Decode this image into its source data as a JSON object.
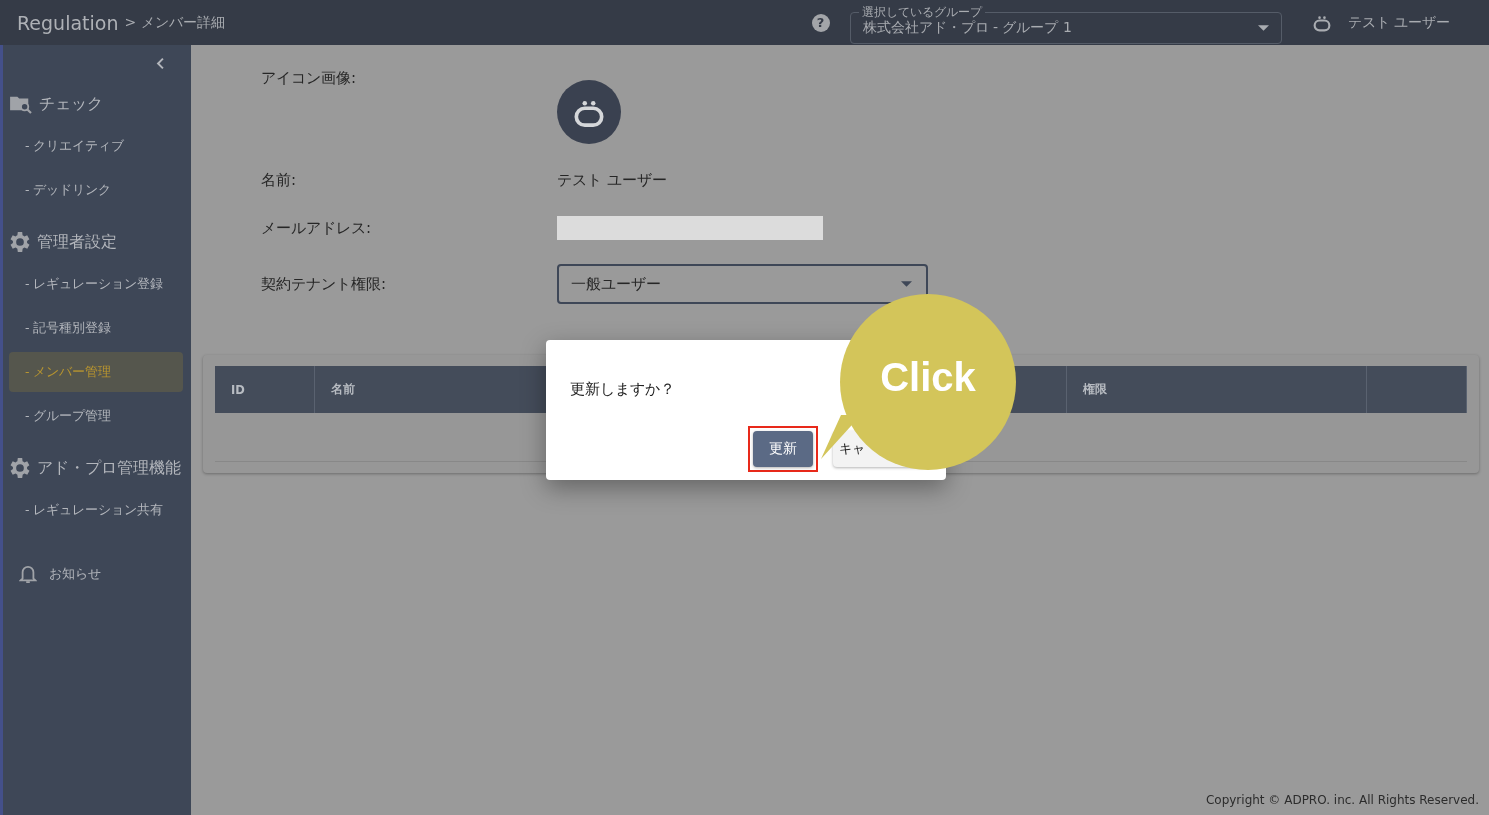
{
  "header": {
    "app_title": "Regulation",
    "breadcrumb": "> メンバー詳細",
    "help": "?",
    "group_select": {
      "label": "選択しているグループ",
      "value": "株式会社アド・プロ - グループ 1"
    },
    "user_name": "テスト ユーザー"
  },
  "sidebar": {
    "sections": [
      {
        "kind": "folder-search",
        "title": "チェック",
        "items": [
          {
            "label": "- クリエイティブ",
            "selected": false
          },
          {
            "label": "- デッドリンク",
            "selected": false
          }
        ]
      },
      {
        "kind": "gear",
        "title": "管理者設定",
        "items": [
          {
            "label": "- レギュレーション登録",
            "selected": false
          },
          {
            "label": "- 記号種別登録",
            "selected": false
          },
          {
            "label": "- メンバー管理",
            "selected": true
          },
          {
            "label": "- グループ管理",
            "selected": false
          }
        ]
      },
      {
        "kind": "gear",
        "title": "アド・プロ管理機能",
        "items": [
          {
            "label": "- レギュレーション共有",
            "selected": false
          }
        ]
      }
    ],
    "notice": "お知らせ"
  },
  "detail": {
    "fields": [
      {
        "kind": "avatar",
        "label": "アイコン画像:"
      },
      {
        "kind": "text",
        "label": "名前:",
        "value": "テスト ユーザー"
      },
      {
        "kind": "redacted",
        "label": "メールアドレス:"
      },
      {
        "kind": "select",
        "label": "契約テナント権限:",
        "value": "一般ユーザー"
      }
    ]
  },
  "table": {
    "columns": [
      "ID",
      "名前",
      "権限"
    ]
  },
  "dialog": {
    "message": "更新しますか？",
    "buttons": [
      {
        "kind": "primary",
        "label": "更新",
        "highlighted": true
      },
      {
        "kind": "secondary",
        "label": "キャ",
        "highlighted": false
      }
    ]
  },
  "callout": {
    "text": "Click"
  },
  "footer": {
    "copyright": "Copyright © ADPRO. inc. All Rights Reserved."
  }
}
